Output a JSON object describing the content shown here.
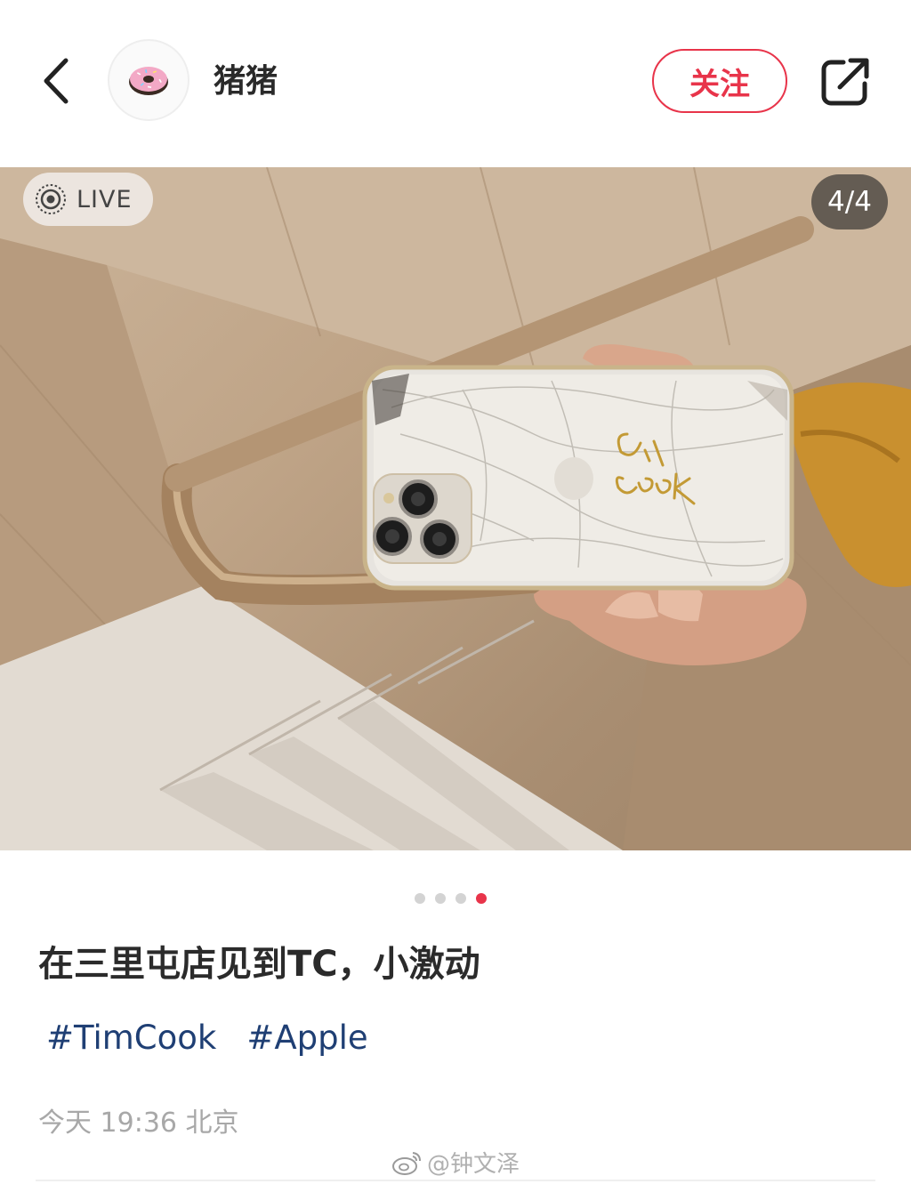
{
  "header": {
    "username": "猪猪",
    "follow_label": "关注",
    "avatar_icon": "donut-icon",
    "back_icon": "chevron-left-icon",
    "share_icon": "share-external-icon"
  },
  "photo": {
    "live_label": "LIVE",
    "counter": "4/4",
    "signature_text": "Tim Cook"
  },
  "pagination": {
    "total": 4,
    "active": 4
  },
  "post": {
    "title": "在三里屯店见到TC，小激动",
    "tags": [
      "#TimCook",
      "#Apple"
    ],
    "meta": "今天 19:36 北京"
  },
  "watermark": "@钟文泽",
  "colors": {
    "accent": "#e8344a",
    "tag": "#1f3f74",
    "meta": "#a8a8a8"
  }
}
